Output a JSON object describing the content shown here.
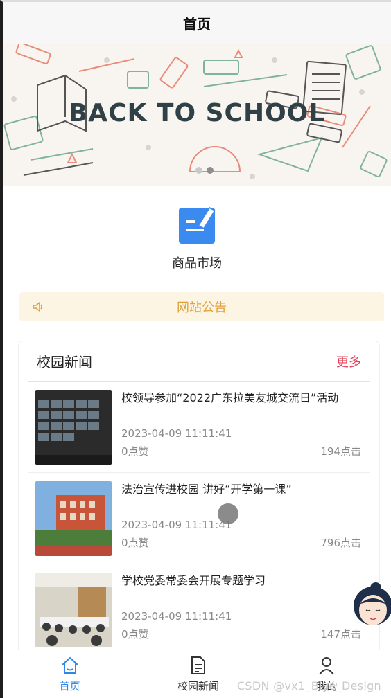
{
  "navbar": {
    "title": "首页"
  },
  "banner": {
    "text": "BACK TO SCHOOL",
    "slides": 2,
    "active_slide": 1
  },
  "category": {
    "label": "商品市场",
    "icon": "edit-icon"
  },
  "notice": {
    "text": "网站公告",
    "icon": "speaker-icon"
  },
  "news": {
    "title": "校园新闻",
    "more": "更多",
    "items": [
      {
        "headline": "校领导参加“2022广东拉美友城交流日”活动",
        "date": "2023-04-09 11:11:41",
        "likes": "0点赞",
        "clicks": "194点击"
      },
      {
        "headline": "法治宣传进校园 讲好“开学第一课”",
        "date": "2023-04-09 11:11:41",
        "likes": "0点赞",
        "clicks": "796点击"
      },
      {
        "headline": "学校党委常委会开展专题学习",
        "date": "2023-04-09 11:11:41",
        "likes": "0点赞",
        "clicks": "147点击"
      }
    ]
  },
  "tabbar": {
    "items": [
      {
        "label": "首页",
        "icon": "home-icon",
        "active": true
      },
      {
        "label": "校园新闻",
        "icon": "document-icon",
        "active": false
      },
      {
        "label": "我的",
        "icon": "user-icon",
        "active": false
      }
    ]
  },
  "watermark": "CSDN @vx1_Biye_Design",
  "colors": {
    "accent": "#2d86e8",
    "more": "#e2435c",
    "notice_text": "#e0a03a",
    "notice_bg": "#fdf5e3"
  }
}
